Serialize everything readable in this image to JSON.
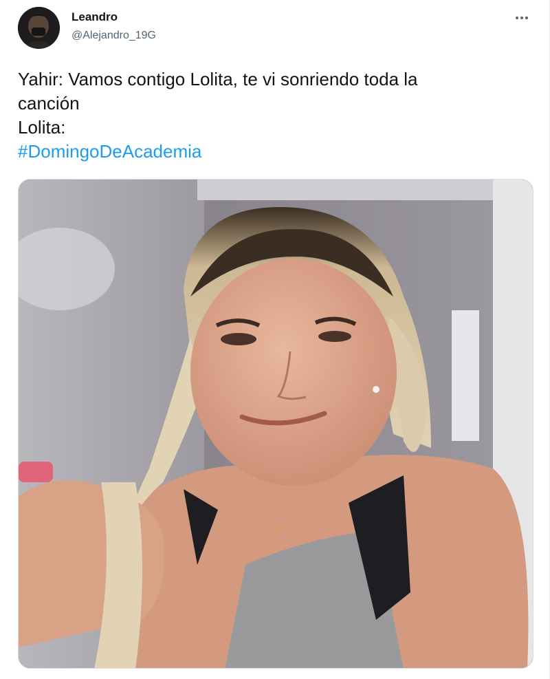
{
  "tweet": {
    "author": {
      "display_name": "Leandro",
      "handle": "@Alejandro_19G",
      "avatar_icon": "user-avatar"
    },
    "more_icon": "more-horizontal-icon",
    "text_lines": [
      "Yahir: Vamos contigo Lolita, te vi sonriendo toda la",
      "canción",
      "Lolita:"
    ],
    "hashtag": "#DomingoDeAcademia",
    "media": {
      "description_icon": "photo-meme",
      "watermark": ""
    }
  },
  "colors": {
    "text": "#0f1419",
    "secondary_text": "#536471",
    "link": "#1d9bf0",
    "border": "#e6ecf0"
  }
}
